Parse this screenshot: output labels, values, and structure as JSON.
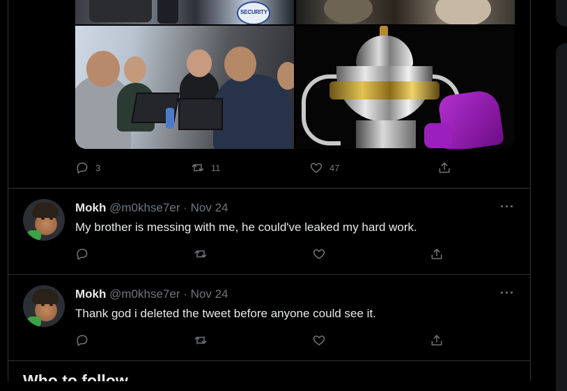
{
  "top_post": {
    "reply_count": "3",
    "retweet_count": "11",
    "like_count": "47"
  },
  "tweets": [
    {
      "name": "Mokh",
      "handle": "@m0khse7er",
      "separator": "·",
      "date": "Nov 24",
      "text": "My brother is messing with me, he could've leaked my hard work.",
      "more": "···"
    },
    {
      "name": "Mokh",
      "handle": "@m0khse7er",
      "separator": "·",
      "date": "Nov 24",
      "text": "Thank god i deleted the tweet before anyone could see it.",
      "more": "···"
    }
  ],
  "sidebar_section": {
    "title": "Who to follow"
  }
}
